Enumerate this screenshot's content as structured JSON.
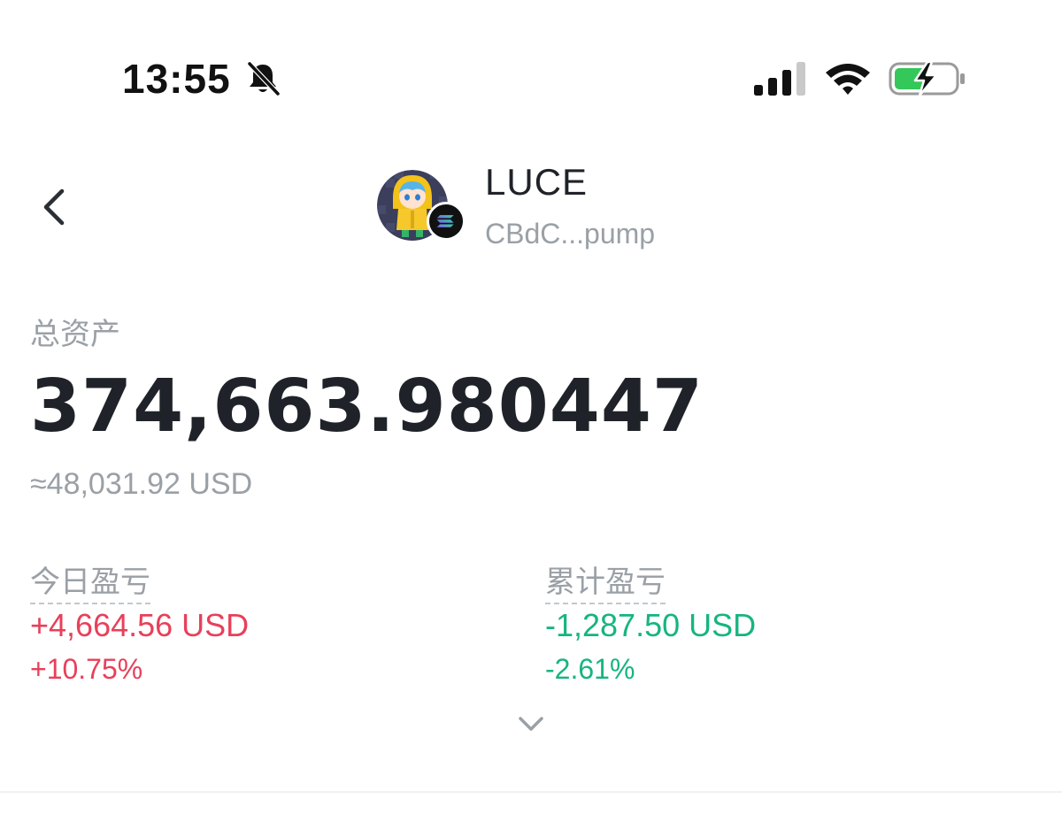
{
  "status_bar": {
    "time": "13:55"
  },
  "header": {
    "token_name": "LUCE",
    "token_address": "CBdC...pump"
  },
  "assets": {
    "label": "总资产",
    "amount": "374,663.980447",
    "usd_value": "≈48,031.92 USD"
  },
  "pnl": {
    "today": {
      "label": "今日盈亏",
      "value": "+4,664.56 USD",
      "percent": "+10.75%"
    },
    "cumulative": {
      "label": "累计盈亏",
      "value": "-1,287.50 USD",
      "percent": "-2.61%"
    }
  },
  "colors": {
    "positive": "#e8405a",
    "negative": "#16b57f",
    "muted": "#9aa0a6",
    "text": "#1f2329"
  },
  "icons": {
    "bell": "bell-off-icon",
    "signal": "signal-icon",
    "wifi": "wifi-icon",
    "battery": "battery-charging-icon",
    "back": "chevron-left-icon",
    "chain": "solana-icon",
    "expand": "chevron-down-icon"
  }
}
